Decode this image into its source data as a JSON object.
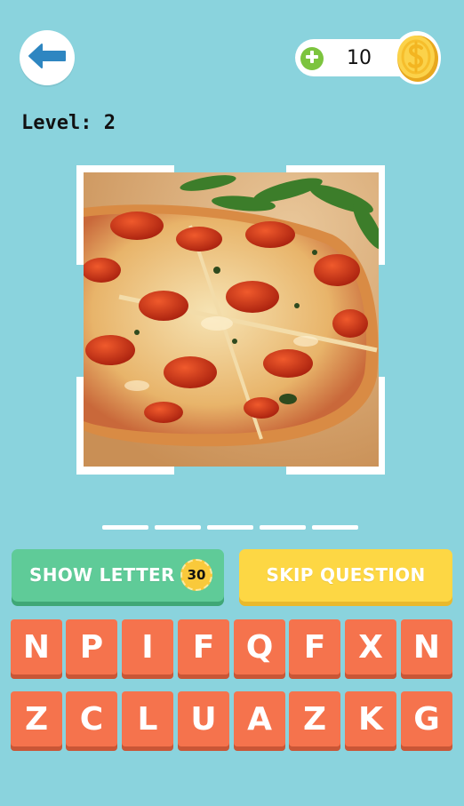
{
  "header": {
    "back_icon": "arrow-left-icon",
    "coins": {
      "plus_icon": "plus-circle-icon",
      "value": "10",
      "coin_icon": "dollar-coin-icon"
    }
  },
  "level": {
    "text": "Level: 2"
  },
  "question_image": {
    "subject": "pizza"
  },
  "answer": {
    "slots": [
      "",
      "",
      "",
      "",
      ""
    ]
  },
  "actions": {
    "show_letter": {
      "label": "SHOW LETTER",
      "cost": "30"
    },
    "skip_question": {
      "label": "SKIP QUESTION"
    }
  },
  "keyboard": {
    "row1": [
      "N",
      "P",
      "I",
      "F",
      "Q",
      "F",
      "X",
      "N"
    ],
    "row2": [
      "Z",
      "C",
      "L",
      "U",
      "A",
      "Z",
      "K",
      "G"
    ]
  },
  "colors": {
    "background": "#8ad3dd",
    "key": "#f5734d",
    "show_letter": "#5fcb98",
    "skip_question": "#fdd744",
    "back_arrow": "#2e86c1",
    "plus": "#7cc43e",
    "coin": "#f9c93b"
  }
}
